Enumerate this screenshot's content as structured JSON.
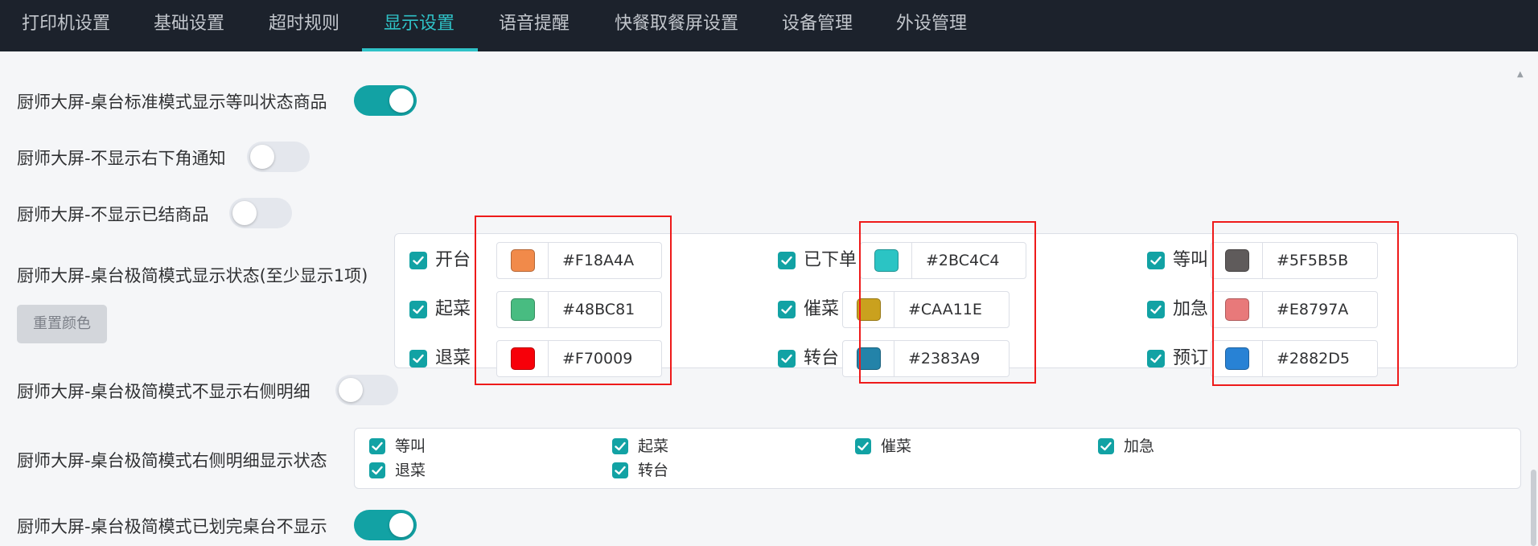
{
  "tabs": [
    {
      "label": "打印机设置",
      "active": false
    },
    {
      "label": "基础设置",
      "active": false
    },
    {
      "label": "超时规则",
      "active": false
    },
    {
      "label": "显示设置",
      "active": true
    },
    {
      "label": "语音提醒",
      "active": false
    },
    {
      "label": "快餐取餐屏设置",
      "active": false
    },
    {
      "label": "设备管理",
      "active": false
    },
    {
      "label": "外设管理",
      "active": false
    }
  ],
  "settings": {
    "show_waiting_items": {
      "label": "厨师大屏-桌台标准模式显示等叫状态商品",
      "enabled": true
    },
    "hide_corner_notice": {
      "label": "厨师大屏-不显示右下角通知",
      "enabled": false
    },
    "hide_settled_items": {
      "label": "厨师大屏-不显示已结商品",
      "enabled": false
    },
    "minimal_status": {
      "label": "厨师大屏-桌台极简模式显示状态(至少显示1项)",
      "reset_label": "重置颜色",
      "items": [
        {
          "name": "开台",
          "checked": true,
          "color": "#F18A4A"
        },
        {
          "name": "已下单",
          "checked": true,
          "color": "#2BC4C4"
        },
        {
          "name": "等叫",
          "checked": true,
          "color": "#5F5B5B"
        },
        {
          "name": "起菜",
          "checked": true,
          "color": "#48BC81"
        },
        {
          "name": "催菜",
          "checked": true,
          "color": "#CAA11E"
        },
        {
          "name": "加急",
          "checked": true,
          "color": "#E8797A"
        },
        {
          "name": "退菜",
          "checked": true,
          "color": "#F70009"
        },
        {
          "name": "转台",
          "checked": true,
          "color": "#2383A9"
        },
        {
          "name": "预订",
          "checked": true,
          "color": "#2882D5"
        }
      ]
    },
    "hide_right_detail": {
      "label": "厨师大屏-桌台极简模式不显示右侧明细",
      "enabled": false
    },
    "right_detail_status": {
      "label": "厨师大屏-桌台极简模式右侧明细显示状态",
      "items": [
        {
          "name": "等叫",
          "checked": true
        },
        {
          "name": "起菜",
          "checked": true
        },
        {
          "name": "催菜",
          "checked": true
        },
        {
          "name": "加急",
          "checked": true
        },
        {
          "name": "退菜",
          "checked": true
        },
        {
          "name": "转台",
          "checked": true
        }
      ]
    },
    "hide_completed_tables": {
      "label": "厨师大屏-桌台极简模式已划完桌台不显示",
      "enabled": true
    }
  },
  "colors": {
    "accent": "#12A2A4",
    "active_tab": "#2FC2C7",
    "topbar_bg": "#1C222C",
    "highlight_box": "#EE1A1A"
  }
}
